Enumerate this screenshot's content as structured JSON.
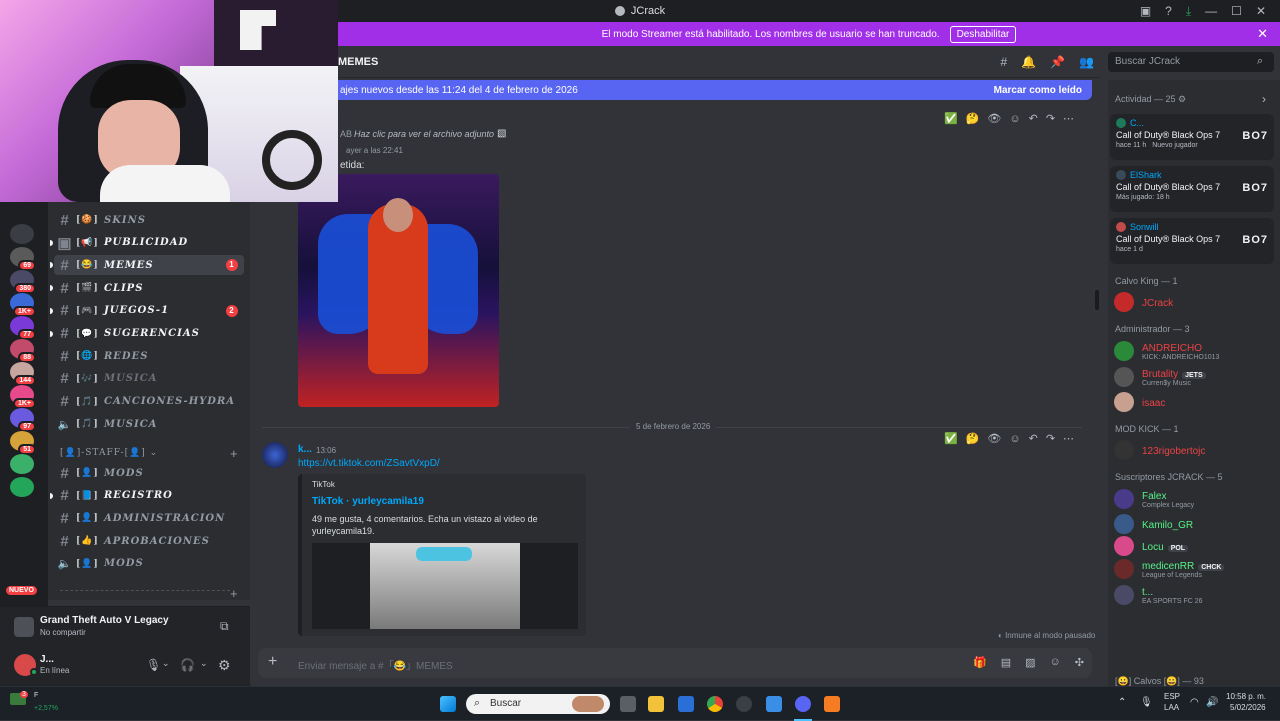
{
  "window": {
    "title": "JCrack"
  },
  "banner": {
    "text": "El modo Streamer está habilitado. Los nombres de usuario se han truncado.",
    "button": "Deshabilitar"
  },
  "header": {
    "channel_name": "MEMES",
    "search_placeholder": "Buscar JCrack"
  },
  "new_messages": {
    "text": "ajes nuevos desde las 11:24 del 4 de febrero de 2026",
    "mark_read": "Marcar como leído"
  },
  "server_badges": [
    "69",
    "380",
    "1K+",
    "77",
    "88",
    "144",
    "1K+",
    "97",
    "51"
  ],
  "server_nuevo": "NUEVO",
  "channels": [
    {
      "icon": "hash",
      "emoji": "[🍪]",
      "name": "SKINS",
      "state": "muted"
    },
    {
      "icon": "rules",
      "emoji": "[📢]",
      "name": "PUBLICIDAD",
      "state": "unread"
    },
    {
      "icon": "hash",
      "emoji": "[😂]",
      "name": "MEMES",
      "state": "active",
      "count": "1"
    },
    {
      "icon": "hash",
      "emoji": "[🎬]",
      "name": "CLIPS",
      "state": "unread"
    },
    {
      "icon": "hash",
      "emoji": "[🎮]",
      "name": "JUEGOS-1",
      "state": "unread",
      "count": "2"
    },
    {
      "icon": "hash",
      "emoji": "[💬]",
      "name": "SUGERENCIAS",
      "state": "unread"
    },
    {
      "icon": "hash",
      "emoji": "[🌐]",
      "name": "REDES",
      "state": "muted"
    },
    {
      "icon": "hash",
      "emoji": "[🎶]",
      "name": "MUSICA",
      "state": "dim"
    },
    {
      "icon": "hash",
      "emoji": "[🎵]",
      "name": "CANCIONES-HYDRA",
      "state": "muted"
    },
    {
      "icon": "speaker",
      "emoji": "[🎵]",
      "name": "MUSICA",
      "state": "muted"
    }
  ],
  "staff_category": "[👤]-STAFF-[👤]",
  "staff_channels": [
    {
      "icon": "hash",
      "emoji": "[👤]",
      "name": "MODS",
      "state": "muted"
    },
    {
      "icon": "hash",
      "emoji": "[📘]",
      "name": "REGISTRO",
      "state": "unread"
    },
    {
      "icon": "hash",
      "emoji": "[👤]",
      "name": "ADMINISTRACION",
      "state": "muted"
    },
    {
      "icon": "hash",
      "emoji": "[👍]",
      "name": "APROBACIONES",
      "state": "muted"
    },
    {
      "icon": "speaker",
      "emoji": "[👤]",
      "name": "MODS",
      "state": "muted"
    }
  ],
  "activity_panel": {
    "game": "Grand Theft Auto V Legacy",
    "status": "No compartir"
  },
  "user_panel": {
    "name": "J...",
    "status": "En línea"
  },
  "messages": {
    "attachment_text": "Haz clic para ver el archivo adjunto",
    "author_prefix": "AB",
    "time1": "ayer a las 22:41",
    "content1": "etida:",
    "date_divider": "5 de febrero de 2026",
    "author2": "k...",
    "time2": "13:06",
    "link": "https://vt.tiktok.com/ZSavtVxpD/",
    "embed_provider": "TikTok",
    "embed_title": "TikTok · yurleycamila19",
    "embed_desc": "49 me gusta, 4 comentarios. Echa un vistazo al video de yurleycamila19.",
    "immune": "Inmune al modo pausado"
  },
  "composer": {
    "placeholder": "Enviar mensaje a #「😂」MEMES"
  },
  "members": {
    "activity_header": "Actividad — 25",
    "activity_cards": [
      {
        "user": "C...",
        "game": "Call of Duty® Black Ops 7",
        "meta1": "hace 11 h",
        "meta2": "Nuevo jugador",
        "logo": "BO7"
      },
      {
        "user": "ElShark",
        "game": "Call of Duty® Black Ops 7",
        "meta1": "Más jugado: 18 h",
        "meta2": "",
        "logo": "BO7"
      },
      {
        "user": "Sonwill",
        "game": "Call of Duty® Black Ops 7",
        "meta1": "hace 1 d",
        "meta2": "",
        "logo": "BO7"
      }
    ],
    "groups": [
      {
        "title": "Calvo King — 1",
        "members": [
          {
            "name": "JCrack",
            "color": "#ed4245",
            "sub": "",
            "tag": ""
          }
        ]
      },
      {
        "title": "Administrador — 3",
        "members": [
          {
            "name": "ANDREICHO",
            "color": "#ed4245",
            "sub": "KICK: ANDREICHO1013",
            "tag": ""
          },
          {
            "name": "Brutality",
            "color": "#ed4245",
            "sub": "Curren$y Music",
            "tag": "JETS"
          },
          {
            "name": "isaac",
            "color": "#ed4245",
            "sub": "",
            "tag": ""
          }
        ]
      },
      {
        "title": "MOD KICK — 1",
        "members": [
          {
            "name": "123rigobertojc",
            "color": "#ed4245",
            "sub": "",
            "tag": ""
          }
        ]
      },
      {
        "title": "Suscriptores JCRACK — 5",
        "members": [
          {
            "name": "Falex",
            "color": "#57f287",
            "sub": "Complex Legacy",
            "tag": ""
          },
          {
            "name": "Kamilo_GR",
            "color": "#57f287",
            "sub": "",
            "tag": ""
          },
          {
            "name": "Locu",
            "color": "#57f287",
            "sub": "",
            "tag": "POL"
          },
          {
            "name": "medicenRR",
            "color": "#57f287",
            "sub": "League of Legends",
            "tag": "CHCK"
          },
          {
            "name": "t...",
            "color": "#57f287",
            "sub": "EA SPORTS FC 26",
            "tag": ""
          }
        ]
      }
    ],
    "calvos": "[😀] Calvos [😀] — 93"
  },
  "taskbar": {
    "weather_temp": "F",
    "weather_change": "+2,57%",
    "search": "Buscar",
    "lang1": "ESP",
    "lang2": "LAA",
    "time": "10:58 p. m.",
    "date": "5/02/2026"
  },
  "colors": {
    "accent": "#5865f2",
    "streamer": "#a12fe8",
    "danger": "#f23f43",
    "link": "#00a8fc"
  }
}
